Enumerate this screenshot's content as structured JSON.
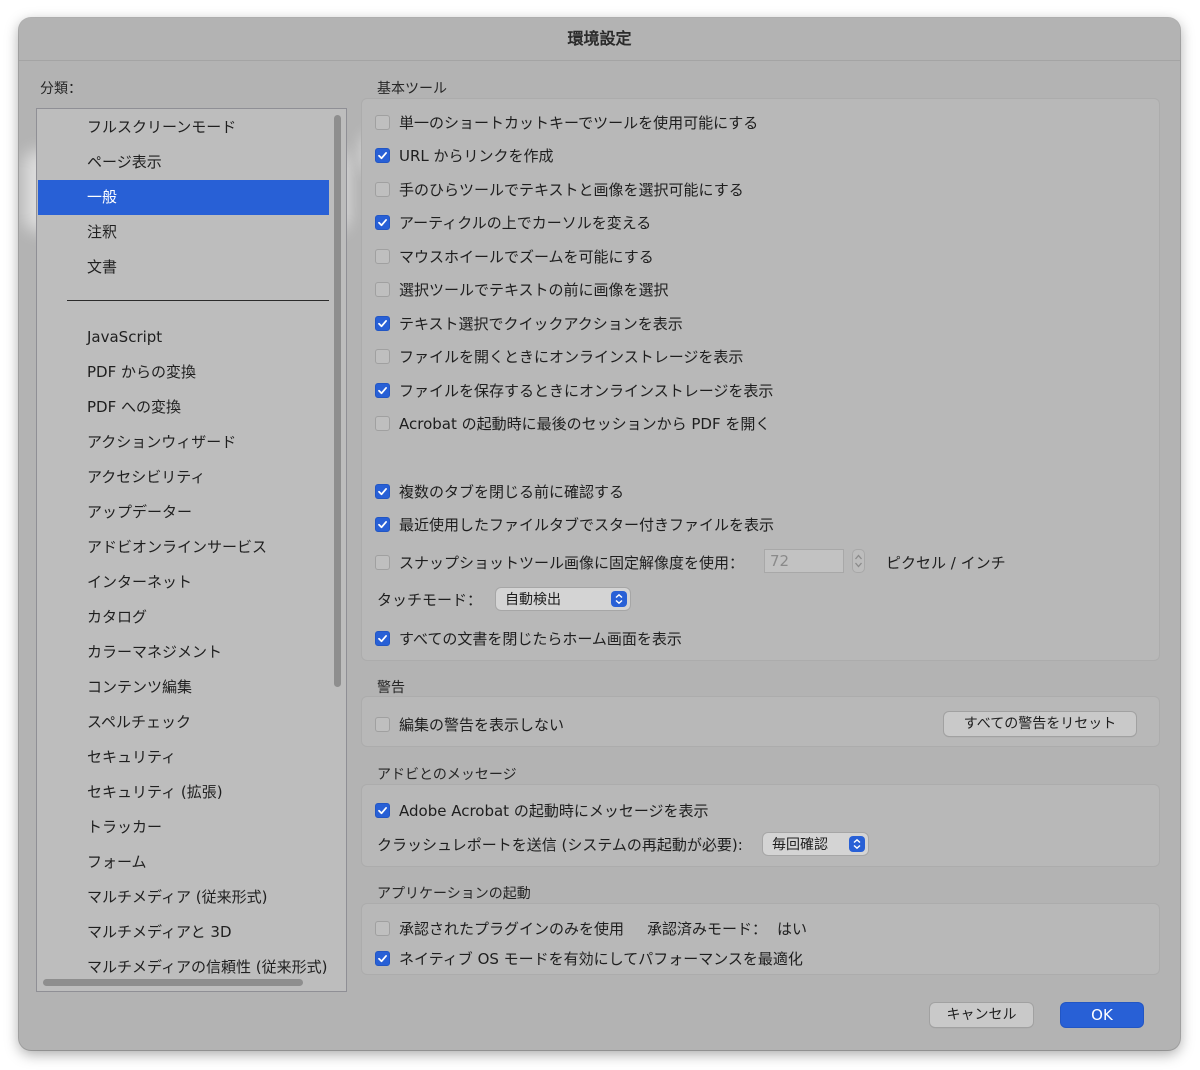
{
  "window": {
    "title": "環境設定"
  },
  "categories": {
    "label": "分類：",
    "top_items": [
      "フルスクリーンモード",
      "ページ表示",
      "一般",
      "注釈",
      "文書"
    ],
    "selected": "一般",
    "items": [
      "JavaScript",
      "PDF からの変換",
      "PDF への変換",
      "アクションウィザード",
      "アクセシビリティ",
      "アップデーター",
      "アドビオンラインサービス",
      "インターネット",
      "カタログ",
      "カラーマネジメント",
      "コンテンツ編集",
      "スペルチェック",
      "セキュリティ",
      "セキュリティ (拡張)",
      "トラッカー",
      "フォーム",
      "マルチメディア (従来形式)",
      "マルチメディアと 3D",
      "マルチメディアの信頼性 (従来形式)"
    ]
  },
  "basic_tools": {
    "title": "基本ツール",
    "checkboxes": [
      {
        "label": "単一のショートカットキーでツールを使用可能にする",
        "checked": false
      },
      {
        "label": "URL からリンクを作成",
        "checked": true
      },
      {
        "label": "手のひらツールでテキストと画像を選択可能にする",
        "checked": false
      },
      {
        "label": "アーティクルの上でカーソルを変える",
        "checked": true
      },
      {
        "label": "マウスホイールでズームを可能にする",
        "checked": false
      },
      {
        "label": "選択ツールでテキストの前に画像を選択",
        "checked": false
      },
      {
        "label": "テキスト選択でクイックアクションを表示",
        "checked": true
      },
      {
        "label": "ファイルを開くときにオンラインストレージを表示",
        "checked": false
      },
      {
        "label": "ファイルを保存するときにオンラインストレージを表示",
        "checked": true
      },
      {
        "label": "Acrobat の起動時に最後のセッションから PDF を開く",
        "checked": false
      }
    ],
    "checkboxes2": [
      {
        "label": "複数のタブを閉じる前に確認する",
        "checked": true
      },
      {
        "label": "最近使用したファイルタブでスター付きファイルを表示",
        "checked": true
      }
    ],
    "snapshot": {
      "label": "スナップショットツール画像に固定解像度を使用：",
      "checked": false,
      "value": "72",
      "unit": "ピクセル / インチ"
    },
    "touch_mode": {
      "label": "タッチモード：",
      "value": "自動検出"
    },
    "home_checkbox": {
      "label": "すべての文書を閉じたらホーム画面を表示",
      "checked": true
    }
  },
  "warnings": {
    "title": "警告",
    "checkbox": {
      "label": "編集の警告を表示しない",
      "checked": false
    },
    "reset_button": "すべての警告をリセット"
  },
  "messages": {
    "title": "アドビとのメッセージ",
    "checkbox": {
      "label": "Adobe Acrobat の起動時にメッセージを表示",
      "checked": true
    },
    "crash_report": {
      "label": "クラッシュレポートを送信 (システムの再起動が必要):",
      "value": "毎回確認"
    }
  },
  "startup": {
    "title": "アプリケーションの起動",
    "plugins": {
      "label": "承認されたプラグインのみを使用",
      "checked": false
    },
    "approved_mode": {
      "label": "承認済みモード：",
      "value": "はい"
    },
    "native_os": {
      "label": "ネイティブ OS モードを有効にしてパフォーマンスを最適化",
      "checked": true
    }
  },
  "footer": {
    "cancel": "キャンセル",
    "ok": "OK"
  },
  "colors": {
    "accent": "#2860d6",
    "window_bg": "#b3b3b3"
  }
}
